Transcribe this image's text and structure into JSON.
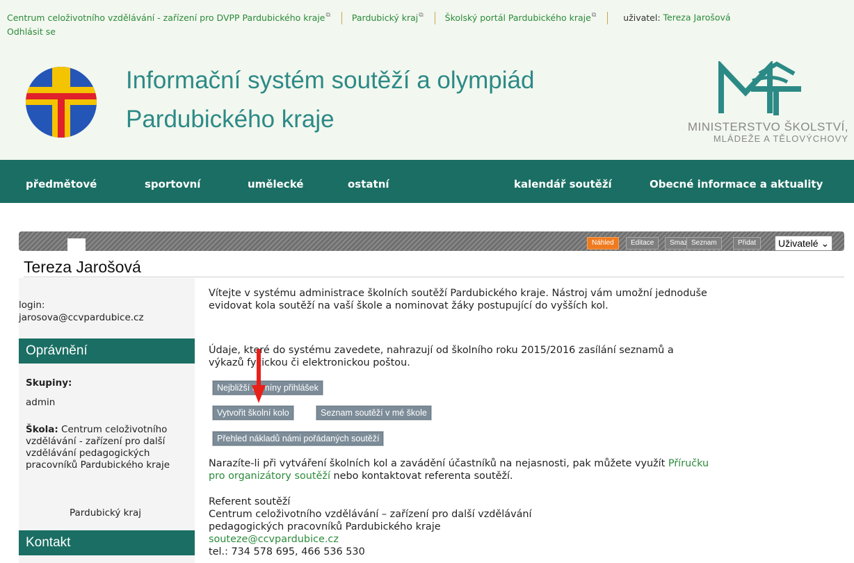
{
  "topbar": {
    "links": [
      "Centrum celoživotního vzdělávání - zařízení pro DVPP Pardubického kraje",
      "Pardubický kraj",
      "Školský portál Pardubického kraje"
    ],
    "user_label": "uživatel:",
    "user_name": "Tereza Jarošová",
    "logout": "Odhlásit se"
  },
  "header": {
    "title_line1": "Informační systém soutěží a olympiád",
    "title_line2": "Pardubického kraje",
    "ministry_line1": "MINISTERSTVO ŠKOLSTVÍ,",
    "ministry_line2": "MLÁDEŽE A TĚLOVÝCHOVY",
    "colors": {
      "title": "#2c8a86",
      "logo_blue": "#2456b8",
      "logo_yellow": "#f5c400",
      "logo_red": "#e0212b"
    }
  },
  "nav": {
    "items": [
      "předmětové",
      "sportovní",
      "umělecké",
      "ostatní",
      "kalendář soutěží",
      "Obecné informace a aktuality"
    ]
  },
  "toolbar": {
    "buttons": [
      "Náhled",
      "Editace",
      "Smazat",
      "Seznam",
      "Přidat"
    ],
    "active": "Náhled",
    "select_value": "Uživatelé"
  },
  "page_title": "Tereza Jarošová",
  "sidebar": {
    "login_label": "login:",
    "login_value": "jarosova@ccvpardubice.cz",
    "permissions_title": "Oprávnění",
    "groups_label": "Skupiny:",
    "groups_value": "admin",
    "school_label": "Škola:",
    "school_value": "Centrum celoživotního vzdělávání - zařízení pro další vzdělávání pedagogických pracovníků Pardubického kraje",
    "region_value": "Pardubický kraj",
    "contact_title": "Kontakt"
  },
  "main": {
    "intro": "Vítejte v systému administrace školních soutěží Pardubického kraje. Nástroj vám umožní jednoduše evidovat kola soutěží na vaší škole a nominovat žáky postupující do vyšších kol.",
    "info": "Údaje, které do systému zavedete, nahrazují od školního roku 2015/2016 zasílání seznamů a výkazů fyzickou či elektronickou poštou.",
    "btn_deadlines": "Nejbližší termíny přihlášek",
    "btn_create_round": "Vytvořit školní kolo",
    "btn_list_competitions": "Seznam soutěží v mé škole",
    "btn_costs": "Přehled nákladů námi pořádaných soutěží",
    "help_text_before": "Narazíte-li při vytváření školních kol a zavádění účastníků na nejasnosti, pak můžete využít ",
    "help_link": "Příručku pro organizátory soutěží",
    "help_text_after": " nebo kontaktovat referenta soutěží.",
    "referent_title": "Referent soutěží",
    "referent_org": "Centrum celoživotního vzdělávání – zařízení pro další vzdělávání pedagogických pracovníků Pardubického kraje",
    "referent_email": "souteze@ccvpardubice.cz",
    "referent_phone": "tel.: 734 578 695, 466 536 530"
  }
}
